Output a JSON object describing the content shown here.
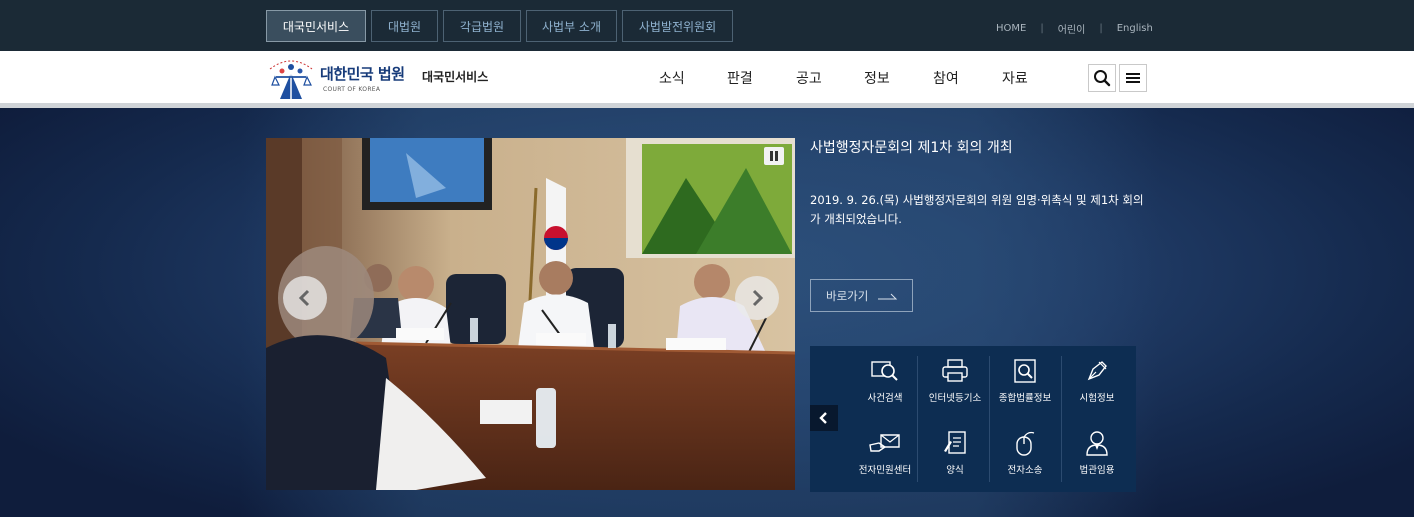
{
  "top_tabs": [
    {
      "label": "대국민서비스",
      "active": true
    },
    {
      "label": "대법원",
      "active": false
    },
    {
      "label": "각급법원",
      "active": false
    },
    {
      "label": "사법부 소개",
      "active": false
    },
    {
      "label": "사법발전위원회",
      "active": false
    }
  ],
  "util_links": [
    "HOME",
    "어린이",
    "English"
  ],
  "logo": {
    "title": "대한민국 법원",
    "subtitle": "COURT OF KOREA",
    "service": "대국민서비스"
  },
  "menu": [
    "소식",
    "판결",
    "공고",
    "정보",
    "참여",
    "자료"
  ],
  "header_icons": [
    "search-icon",
    "hamburger-menu-icon"
  ],
  "slide": {
    "title": "사법행정자문회의 제1차 회의 개최",
    "description": "2019. 9. 26.(목) 사법행정자문회의 위원 임명·위촉식 및 제1차 회의가 개최되었습니다.",
    "goto_label": "바로가기"
  },
  "quick_links": [
    {
      "label": "사건검색",
      "icon": "magnifier-screen-icon"
    },
    {
      "label": "인터넷등기소",
      "icon": "printer-icon"
    },
    {
      "label": "종합법률정보",
      "icon": "book-search-icon"
    },
    {
      "label": "시험정보",
      "icon": "pen-nib-icon"
    },
    {
      "label": "전자민원센터",
      "icon": "envelope-hand-icon"
    },
    {
      "label": "양식",
      "icon": "document-pen-icon"
    },
    {
      "label": "전자소송",
      "icon": "mouse-icon"
    },
    {
      "label": "법관임용",
      "icon": "judge-person-icon"
    }
  ],
  "colors": {
    "topbar_bg": "#1b2a36",
    "tab_text": "#8fb2cf",
    "logo_blue": "#173b7a",
    "hero_bg": "#1f3a64",
    "quick_panel_bg": "#0d2d52"
  }
}
